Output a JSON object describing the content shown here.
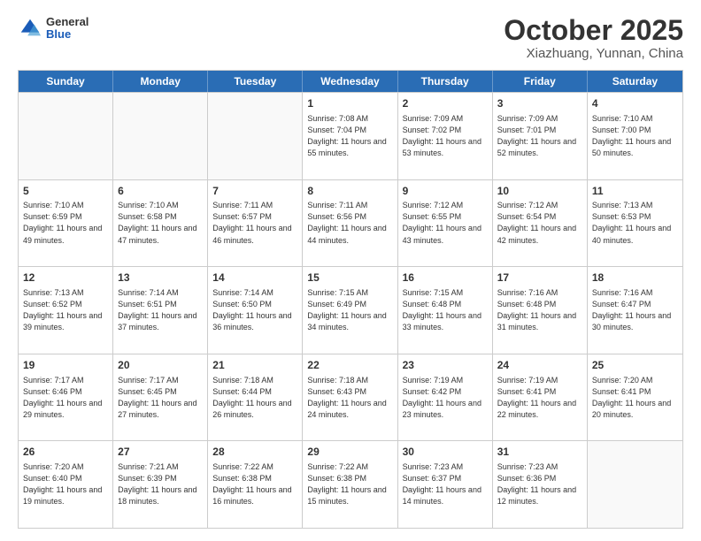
{
  "header": {
    "logo": {
      "general": "General",
      "blue": "Blue"
    },
    "title": "October 2025",
    "location": "Xiazhuang, Yunnan, China"
  },
  "weekdays": [
    "Sunday",
    "Monday",
    "Tuesday",
    "Wednesday",
    "Thursday",
    "Friday",
    "Saturday"
  ],
  "weeks": [
    [
      {
        "day": "",
        "info": ""
      },
      {
        "day": "",
        "info": ""
      },
      {
        "day": "",
        "info": ""
      },
      {
        "day": "1",
        "info": "Sunrise: 7:08 AM\nSunset: 7:04 PM\nDaylight: 11 hours and 55 minutes."
      },
      {
        "day": "2",
        "info": "Sunrise: 7:09 AM\nSunset: 7:02 PM\nDaylight: 11 hours and 53 minutes."
      },
      {
        "day": "3",
        "info": "Sunrise: 7:09 AM\nSunset: 7:01 PM\nDaylight: 11 hours and 52 minutes."
      },
      {
        "day": "4",
        "info": "Sunrise: 7:10 AM\nSunset: 7:00 PM\nDaylight: 11 hours and 50 minutes."
      }
    ],
    [
      {
        "day": "5",
        "info": "Sunrise: 7:10 AM\nSunset: 6:59 PM\nDaylight: 11 hours and 49 minutes."
      },
      {
        "day": "6",
        "info": "Sunrise: 7:10 AM\nSunset: 6:58 PM\nDaylight: 11 hours and 47 minutes."
      },
      {
        "day": "7",
        "info": "Sunrise: 7:11 AM\nSunset: 6:57 PM\nDaylight: 11 hours and 46 minutes."
      },
      {
        "day": "8",
        "info": "Sunrise: 7:11 AM\nSunset: 6:56 PM\nDaylight: 11 hours and 44 minutes."
      },
      {
        "day": "9",
        "info": "Sunrise: 7:12 AM\nSunset: 6:55 PM\nDaylight: 11 hours and 43 minutes."
      },
      {
        "day": "10",
        "info": "Sunrise: 7:12 AM\nSunset: 6:54 PM\nDaylight: 11 hours and 42 minutes."
      },
      {
        "day": "11",
        "info": "Sunrise: 7:13 AM\nSunset: 6:53 PM\nDaylight: 11 hours and 40 minutes."
      }
    ],
    [
      {
        "day": "12",
        "info": "Sunrise: 7:13 AM\nSunset: 6:52 PM\nDaylight: 11 hours and 39 minutes."
      },
      {
        "day": "13",
        "info": "Sunrise: 7:14 AM\nSunset: 6:51 PM\nDaylight: 11 hours and 37 minutes."
      },
      {
        "day": "14",
        "info": "Sunrise: 7:14 AM\nSunset: 6:50 PM\nDaylight: 11 hours and 36 minutes."
      },
      {
        "day": "15",
        "info": "Sunrise: 7:15 AM\nSunset: 6:49 PM\nDaylight: 11 hours and 34 minutes."
      },
      {
        "day": "16",
        "info": "Sunrise: 7:15 AM\nSunset: 6:48 PM\nDaylight: 11 hours and 33 minutes."
      },
      {
        "day": "17",
        "info": "Sunrise: 7:16 AM\nSunset: 6:48 PM\nDaylight: 11 hours and 31 minutes."
      },
      {
        "day": "18",
        "info": "Sunrise: 7:16 AM\nSunset: 6:47 PM\nDaylight: 11 hours and 30 minutes."
      }
    ],
    [
      {
        "day": "19",
        "info": "Sunrise: 7:17 AM\nSunset: 6:46 PM\nDaylight: 11 hours and 29 minutes."
      },
      {
        "day": "20",
        "info": "Sunrise: 7:17 AM\nSunset: 6:45 PM\nDaylight: 11 hours and 27 minutes."
      },
      {
        "day": "21",
        "info": "Sunrise: 7:18 AM\nSunset: 6:44 PM\nDaylight: 11 hours and 26 minutes."
      },
      {
        "day": "22",
        "info": "Sunrise: 7:18 AM\nSunset: 6:43 PM\nDaylight: 11 hours and 24 minutes."
      },
      {
        "day": "23",
        "info": "Sunrise: 7:19 AM\nSunset: 6:42 PM\nDaylight: 11 hours and 23 minutes."
      },
      {
        "day": "24",
        "info": "Sunrise: 7:19 AM\nSunset: 6:41 PM\nDaylight: 11 hours and 22 minutes."
      },
      {
        "day": "25",
        "info": "Sunrise: 7:20 AM\nSunset: 6:41 PM\nDaylight: 11 hours and 20 minutes."
      }
    ],
    [
      {
        "day": "26",
        "info": "Sunrise: 7:20 AM\nSunset: 6:40 PM\nDaylight: 11 hours and 19 minutes."
      },
      {
        "day": "27",
        "info": "Sunrise: 7:21 AM\nSunset: 6:39 PM\nDaylight: 11 hours and 18 minutes."
      },
      {
        "day": "28",
        "info": "Sunrise: 7:22 AM\nSunset: 6:38 PM\nDaylight: 11 hours and 16 minutes."
      },
      {
        "day": "29",
        "info": "Sunrise: 7:22 AM\nSunset: 6:38 PM\nDaylight: 11 hours and 15 minutes."
      },
      {
        "day": "30",
        "info": "Sunrise: 7:23 AM\nSunset: 6:37 PM\nDaylight: 11 hours and 14 minutes."
      },
      {
        "day": "31",
        "info": "Sunrise: 7:23 AM\nSunset: 6:36 PM\nDaylight: 11 hours and 12 minutes."
      },
      {
        "day": "",
        "info": ""
      }
    ]
  ]
}
